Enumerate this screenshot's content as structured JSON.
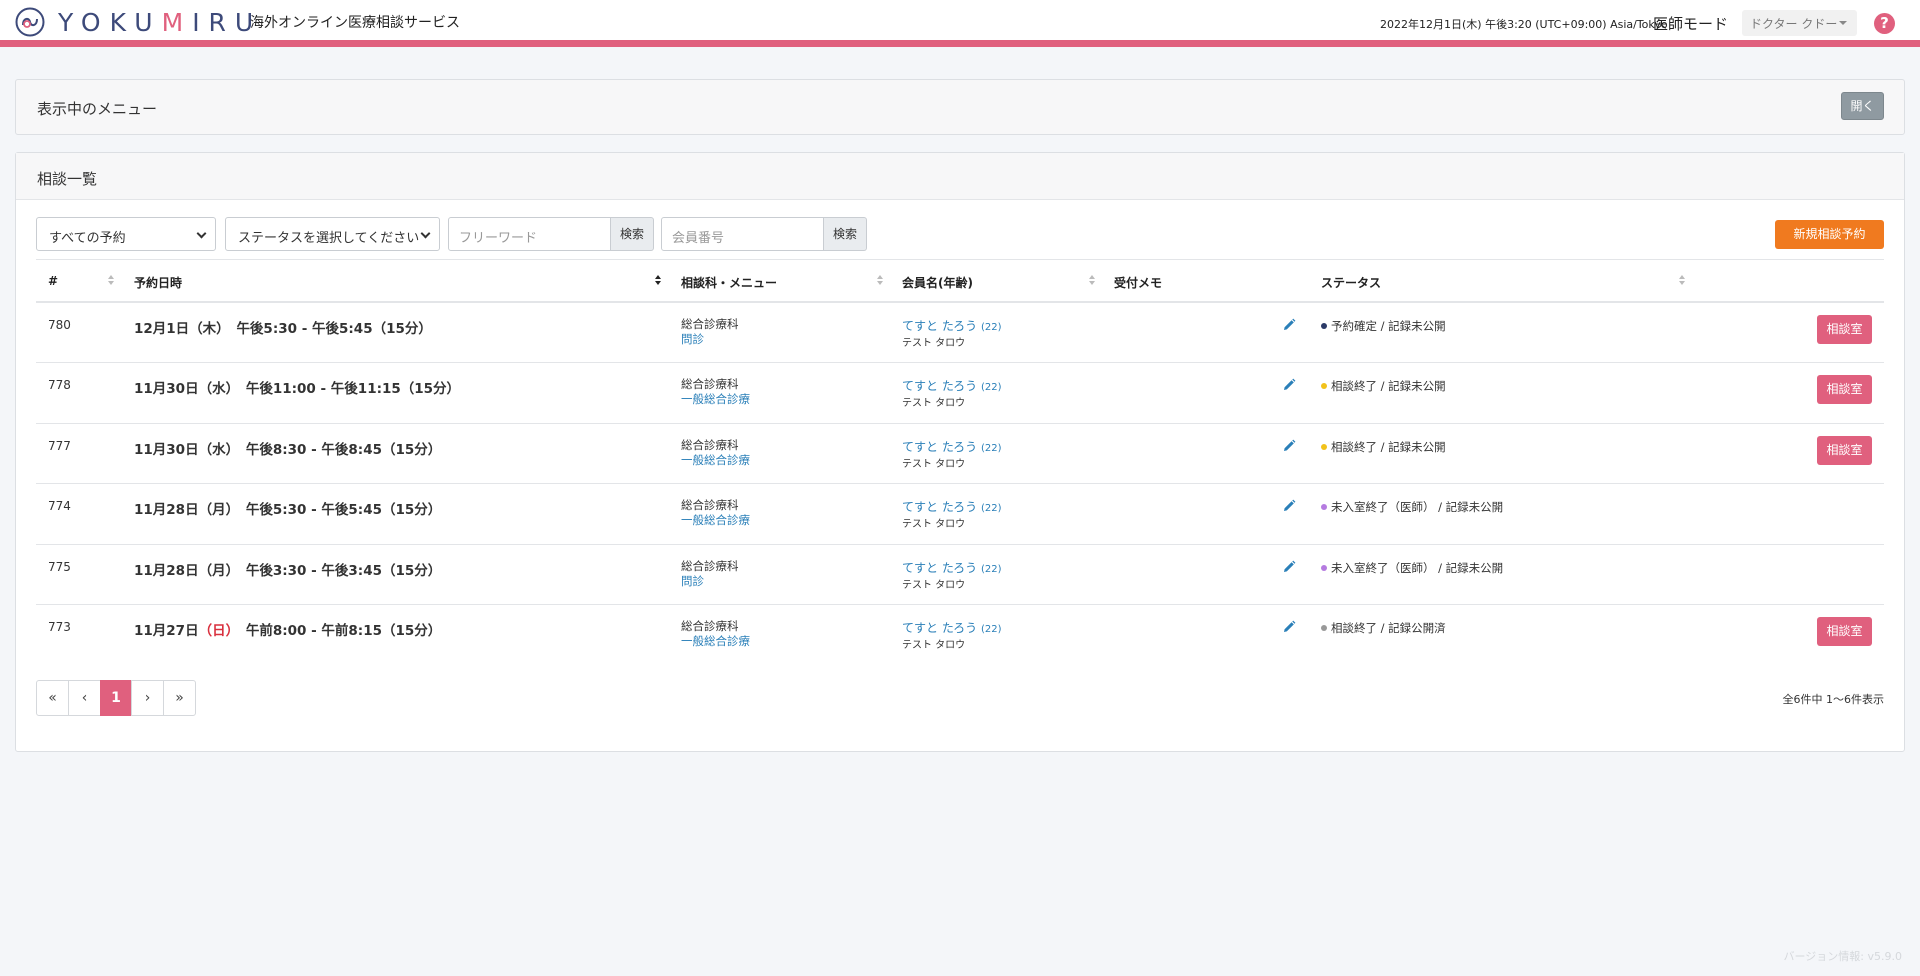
{
  "header": {
    "logo_text": "YOKU",
    "logo_heart": "M",
    "logo_text2": "IRU",
    "tagline": "海外オンライン医療相談サービス",
    "datetime": "2022年12月1日(木) 午後3:20 (UTC+09:00) Asia/Tokyo",
    "mode": "医師モード",
    "user": "ドクター クドー",
    "help": "?"
  },
  "menu_card": {
    "title": "表示中のメニュー",
    "open_label": "開く"
  },
  "list_card": {
    "title": "相談一覧",
    "filter_reservation": "すべての予約",
    "filter_status": "ステータスを選択してください",
    "freeword_placeholder": "フリーワード",
    "search_label": "検索",
    "member_placeholder": "会員番号",
    "new_button": "新規相談予約",
    "columns": {
      "id": "#",
      "date": "予約日時",
      "dept": "相談科・メニュー",
      "member": "会員名(年齢)",
      "memo": "受付メモ",
      "status": "ステータス"
    },
    "room_label": "相談室",
    "rows": [
      {
        "id": "780",
        "date": "12月1日（木）",
        "date_sun": "",
        "time": "午後5:30 - 午後5:45（15分）",
        "dept": "総合診療科",
        "menu": "問診",
        "name": "てすと たろう",
        "age": "(22)",
        "kana": "テスト タロウ",
        "status": "予約確定 / 記録未公開",
        "dot": "#2b3a67"
      },
      {
        "id": "778",
        "date": "11月30日（水）",
        "date_sun": "",
        "time": "午後11:00 - 午後11:15（15分）",
        "dept": "総合診療科",
        "menu": "一般総合診療",
        "name": "てすと たろう",
        "age": "(22)",
        "kana": "テスト タロウ",
        "status": "相談終了 / 記録未公開",
        "dot": "#f2c21b"
      },
      {
        "id": "777",
        "date": "11月30日（水）",
        "date_sun": "",
        "time": "午後8:30 - 午後8:45（15分）",
        "dept": "総合診療科",
        "menu": "一般総合診療",
        "name": "てすと たろう",
        "age": "(22)",
        "kana": "テスト タロウ",
        "status": "相談終了 / 記録未公開",
        "dot": "#f2c21b"
      },
      {
        "id": "774",
        "date": "11月28日（月）",
        "date_sun": "",
        "time": "午後5:30 - 午後5:45（15分）",
        "dept": "総合診療科",
        "menu": "一般総合診療",
        "name": "てすと たろう",
        "age": "(22)",
        "kana": "テスト タロウ",
        "status": "未入室終了（医師） / 記録未公開",
        "dot": "#b57be0"
      },
      {
        "id": "775",
        "date": "11月28日（月）",
        "date_sun": "",
        "time": "午後3:30 - 午後3:45（15分）",
        "dept": "総合診療科",
        "menu": "問診",
        "name": "てすと たろう",
        "age": "(22)",
        "kana": "テスト タロウ",
        "status": "未入室終了（医師） / 記録未公開",
        "dot": "#b57be0"
      },
      {
        "id": "773",
        "date": "11月27日",
        "date_sun": "（日）",
        "time": "午前8:00 - 午前8:15（15分）",
        "dept": "総合診療科",
        "menu": "一般総合診療",
        "name": "てすと たろう",
        "age": "(22)",
        "kana": "テスト タロウ",
        "status": "相談終了 / 記録公開済",
        "dot": "#999999"
      }
    ],
    "room_visible": [
      true,
      true,
      true,
      false,
      false,
      true
    ],
    "pager": [
      "«",
      "‹",
      "1",
      "›",
      "»"
    ],
    "total": "全6件中 1〜6件表示"
  },
  "version": "バージョン情報: v5.9.0"
}
